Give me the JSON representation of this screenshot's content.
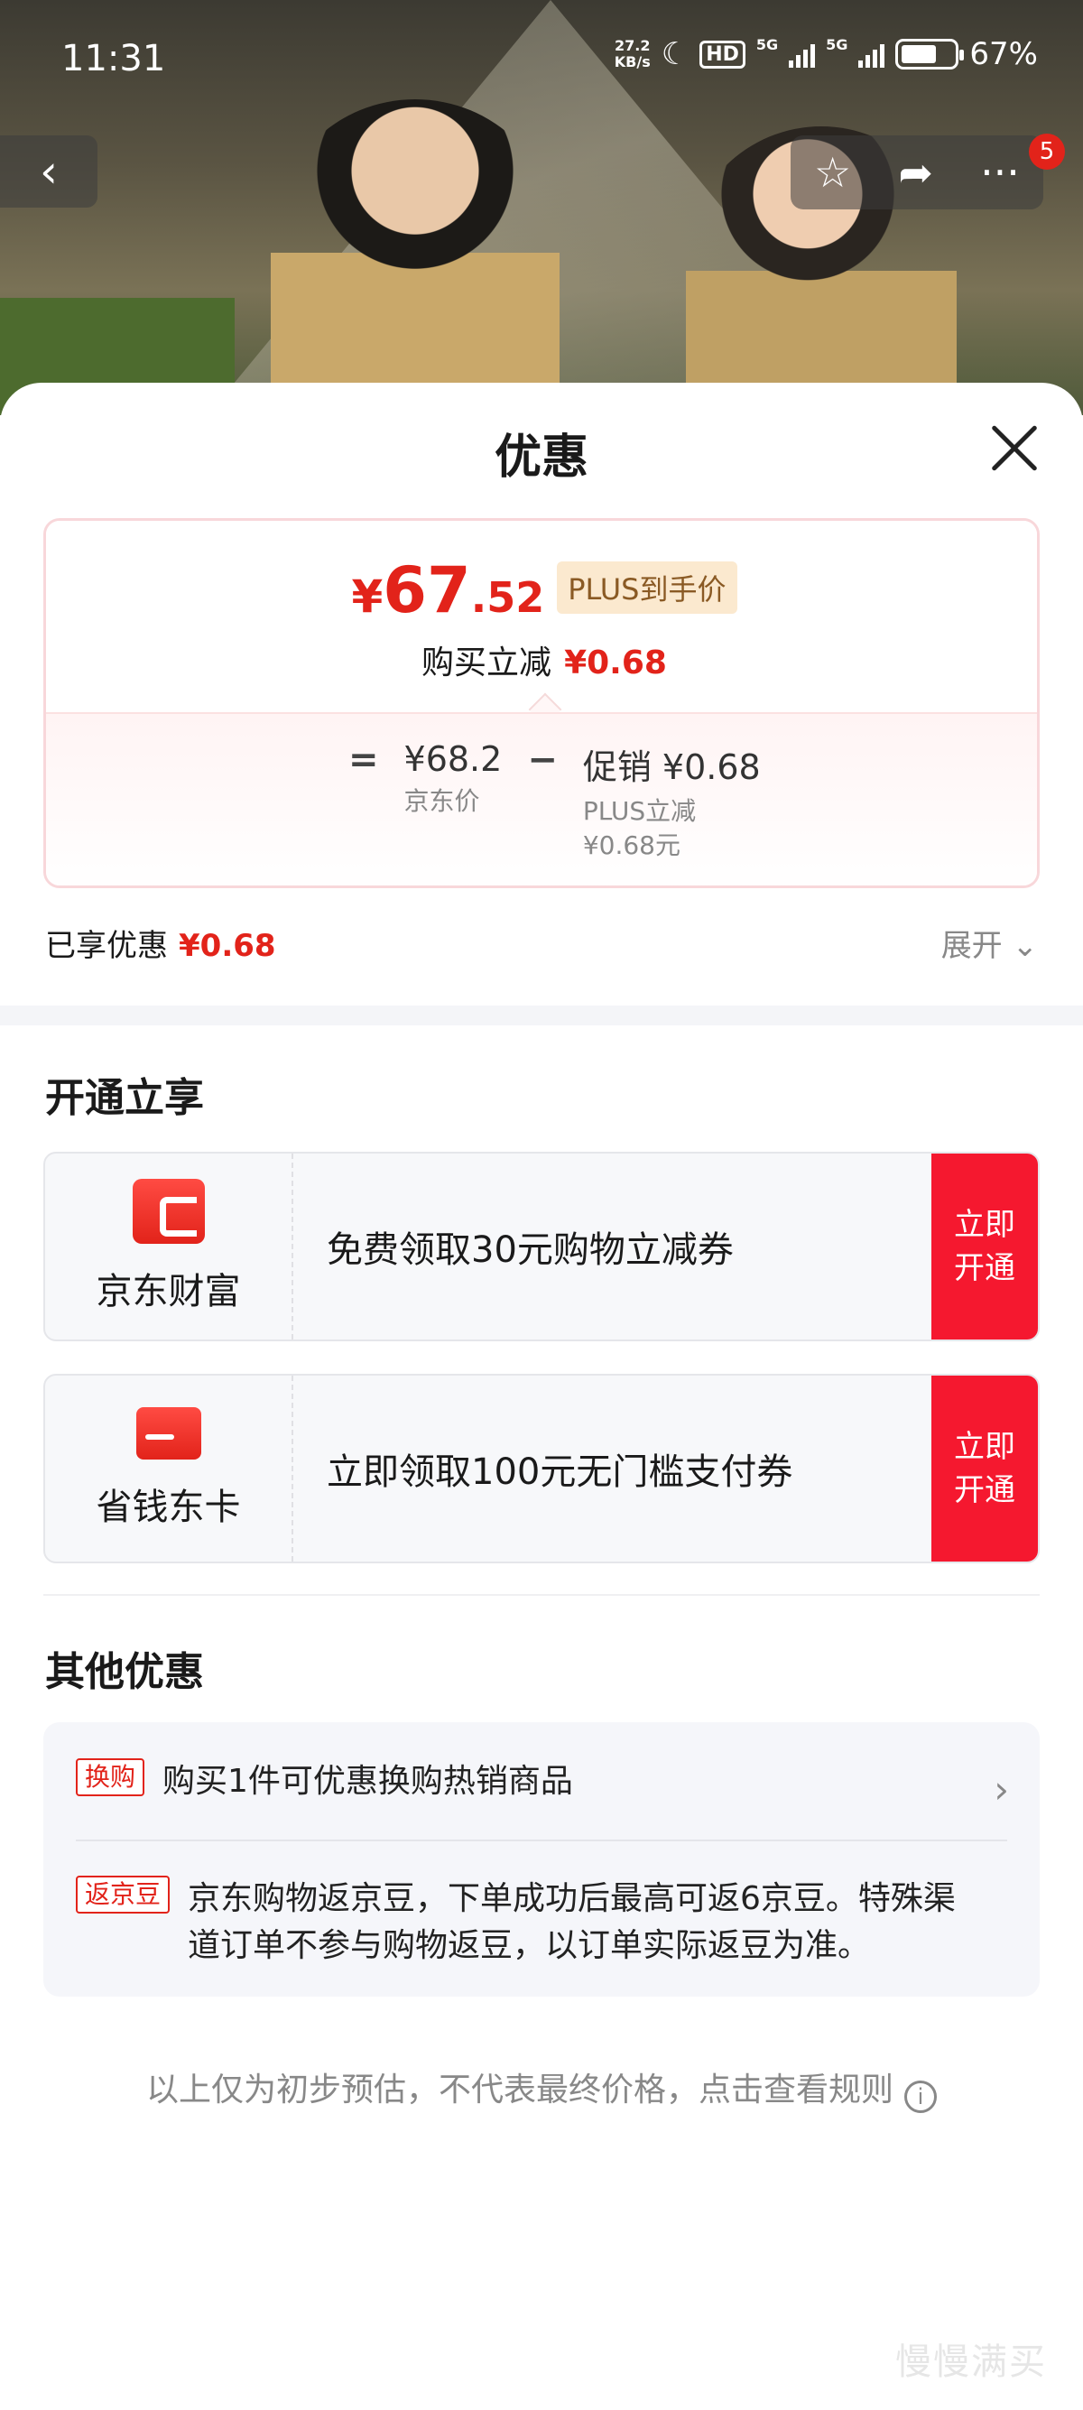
{
  "status_bar": {
    "time": "11:31",
    "net_speed_value": "27.2",
    "net_speed_unit": "KB/s",
    "hd_label": "HD",
    "signal1_label": "5G",
    "signal2_label": "5G",
    "battery_percent": "67%",
    "battery_level": 0.67
  },
  "nav": {
    "notification_count": "5"
  },
  "sheet": {
    "title": "优惠"
  },
  "price": {
    "currency": "¥",
    "integer": "67",
    "decimal": ".52",
    "plus_tag": "PLUS到手价",
    "instant_label": "购买立减",
    "instant_value": "¥0.68",
    "eq": "=",
    "jd_price": "¥68.2",
    "jd_price_label": "京东价",
    "minus": "−",
    "promo_label": "促销 ¥0.68",
    "promo_detail_1": "PLUS立减",
    "promo_detail_2": "¥0.68元"
  },
  "enjoyed": {
    "label": "已享优惠",
    "value": "¥0.68",
    "expand": "展开"
  },
  "open_section": {
    "title": "开通立享",
    "cards": [
      {
        "name": "京东财富",
        "text": "免费领取30元购物立减券",
        "button": "立即开通"
      },
      {
        "name": "省钱东卡",
        "text": "立即领取100元无门槛支付券",
        "button": "立即开通"
      }
    ]
  },
  "other_section": {
    "title": "其他优惠",
    "rows": [
      {
        "tag": "换购",
        "text": "购买1件可优惠换购热销商品"
      },
      {
        "tag": "返京豆",
        "text": "京东购物返京豆，下单成功后最高可返6京豆。特殊渠道订单不参与购物返豆，以订单实际返豆为准。"
      }
    ]
  },
  "footnote": "以上仅为初步预估，不代表最终价格，点击查看规则",
  "watermark": "慢慢满买",
  "colors": {
    "accent": "#e2231a",
    "button": "#f5182f",
    "plus_tag_bg": "#fbe9cf"
  }
}
